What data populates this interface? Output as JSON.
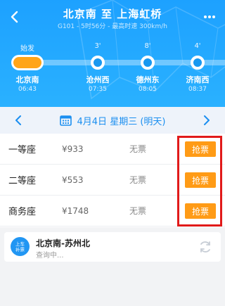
{
  "header": {
    "title": "北京南 至 上海虹桥",
    "subtitle": "G101 - 5时56分 - 最高时速 300km/h"
  },
  "timeline": {
    "stops": [
      {
        "top": "始发",
        "name": "北京南",
        "time": "06:43"
      },
      {
        "top": "3'",
        "name": "沧州西",
        "time": "07:35"
      },
      {
        "top": "8'",
        "name": "德州东",
        "time": "08:05"
      },
      {
        "top": "4'",
        "name": "济南西",
        "time": "08:37"
      }
    ]
  },
  "datebar": {
    "date": "4月4日 星期三 (明天)"
  },
  "seats": [
    {
      "class": "一等座",
      "price": "¥933",
      "availability": "无票",
      "action": "抢票"
    },
    {
      "class": "二等座",
      "price": "¥553",
      "availability": "无票",
      "action": "抢票"
    },
    {
      "class": "商务座",
      "price": "¥1748",
      "availability": "无票",
      "action": "抢票"
    }
  ],
  "transfer": {
    "badge_line1": "上车",
    "badge_line2": "补票",
    "route": "北京南-苏州北",
    "status": "查询中..."
  },
  "colors": {
    "header_blue": "#1da1ff",
    "accent_orange": "#ff9b16",
    "highlight_red": "#e11a1a",
    "date_blue": "#1b8ff0"
  }
}
